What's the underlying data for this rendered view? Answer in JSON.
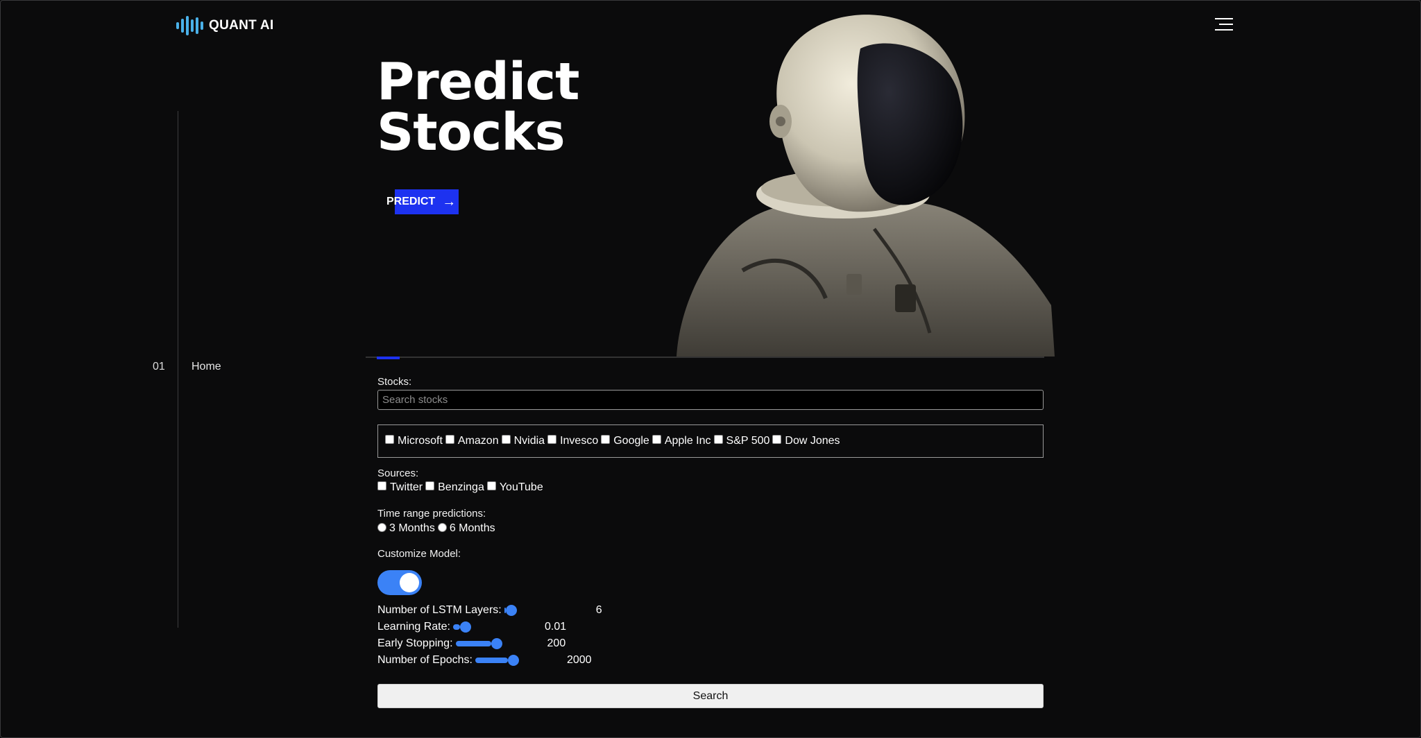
{
  "header": {
    "brand": "QUANT AI",
    "logo_icon": "soundwave-logo-icon",
    "menu_icon": "hamburger-menu-icon",
    "accent_color": "#1d32f0"
  },
  "sidebar": {
    "items": [
      {
        "number": "01",
        "label": "Home"
      }
    ]
  },
  "hero": {
    "title_line1": "Predict",
    "title_line2": "Stocks",
    "cta_label": "PREDICT",
    "cta_icon": "arrow-right-icon",
    "image": "astronaut-photo"
  },
  "form": {
    "stocks_label": "Stocks:",
    "stocks_placeholder": "Search stocks",
    "stocks": [
      "Microsoft",
      "Amazon",
      "Nvidia",
      "Invesco",
      "Google",
      "Apple Inc",
      "S&P 500",
      "Dow Jones"
    ],
    "sources_label": "Sources:",
    "sources": [
      "Twitter",
      "Benzinga",
      "YouTube"
    ],
    "time_range_label": "Time range predictions:",
    "time_ranges": [
      "3 Months",
      "6 Months"
    ],
    "customize_label": "Customize Model:",
    "customize_enabled": true,
    "sliders": [
      {
        "label": "Number of LSTM Layers:",
        "value": "6",
        "fraction": 0.02
      },
      {
        "label": "Learning Rate:",
        "value": "0.01",
        "fraction": 0.08
      },
      {
        "label": "Early Stopping:",
        "value": "200",
        "fraction": 0.4
      },
      {
        "label": "Number of Epochs:",
        "value": "2000",
        "fraction": 0.37
      }
    ],
    "search_button": "Search"
  }
}
